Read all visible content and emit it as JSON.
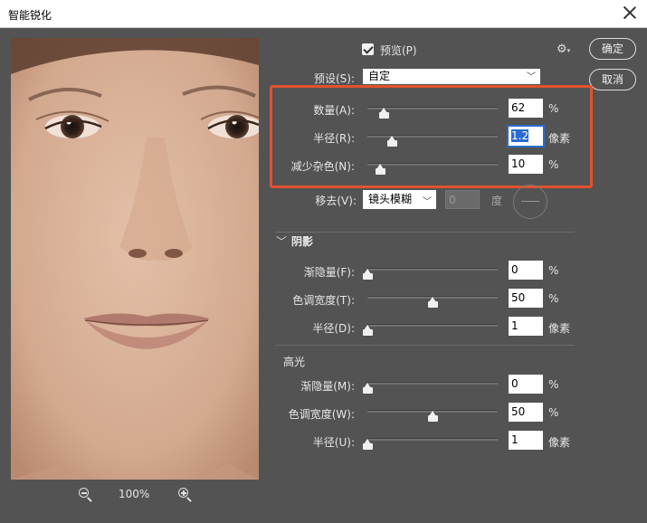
{
  "window": {
    "title": "智能锐化"
  },
  "buttons": {
    "ok": "确定",
    "cancel": "取消"
  },
  "preview": {
    "checkbox_label": "预览(P)",
    "checked": true,
    "zoom": "100%"
  },
  "preset": {
    "label": "预设(S):",
    "value": "自定"
  },
  "main": {
    "amount": {
      "label": "数量(A):",
      "value": "62",
      "unit": "%",
      "level": 0.124
    },
    "radius": {
      "label": "半径(R):",
      "value": "1.2",
      "unit": "像素",
      "level": 0.19
    },
    "noise": {
      "label": "减少杂色(N):",
      "value": "10",
      "unit": "%",
      "level": 0.1
    }
  },
  "remove": {
    "label": "移去(V):",
    "value": "镜头模糊",
    "angle": "0",
    "angle_unit": "度"
  },
  "shadows": {
    "title": "阴影",
    "fade": {
      "label": "渐隐量(F):",
      "value": "0",
      "unit": "%",
      "level": 0.0
    },
    "tonal": {
      "label": "色调宽度(T):",
      "value": "50",
      "unit": "%",
      "level": 0.5
    },
    "radius": {
      "label": "半径(D):",
      "value": "1",
      "unit": "像素",
      "level": 0.0
    }
  },
  "highlights": {
    "title": "高光",
    "fade": {
      "label": "渐隐量(M):",
      "value": "0",
      "unit": "%",
      "level": 0.0
    },
    "tonal": {
      "label": "色调宽度(W):",
      "value": "50",
      "unit": "%",
      "level": 0.5
    },
    "radius": {
      "label": "半径(U):",
      "value": "1",
      "unit": "像素",
      "level": 0.0
    }
  }
}
